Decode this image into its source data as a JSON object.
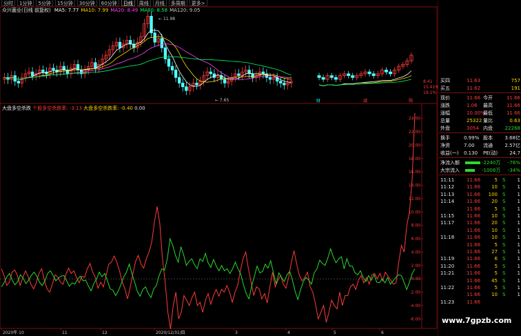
{
  "period_tabs": [
    "分时",
    "1分钟",
    "5分钟",
    "15分钟",
    "30分钟",
    "60分钟",
    "日线",
    "周线",
    "月线",
    "多周期",
    "更多>"
  ],
  "active_tab": "日线",
  "main_chart": {
    "name": "众兴菌业(日线 前复权)",
    "ma": [
      {
        "label": "MA5: 7.77",
        "color": "#ffffff"
      },
      {
        "label": "MA10: 7.99",
        "color": "#ffd700"
      },
      {
        "label": "MA20: 8.49",
        "color": "#ff44ff"
      },
      {
        "label": "MA60: 8.58",
        "color": "#00ff66"
      },
      {
        "label": "MA120: 9.05",
        "color": "#c8c8c8"
      }
    ],
    "high_label": "11.98",
    "low_label": "7.65",
    "right_labels": [
      "8.41",
      "15.41%",
      "19.1%"
    ],
    "markers": [
      "财",
      "减",
      "购"
    ]
  },
  "indicator": {
    "name": "大盘多空杀跌",
    "line1_label": "个股多空杀跌率: -3.13",
    "line1_color": "#ff3b3b",
    "line2_label": "大盘多空杀跌率: -0.40",
    "line2_color": "#2bd92b",
    "line3_label": "0.00",
    "y_ticks": [
      "24.00",
      "22.00",
      "20.00",
      "18.00",
      "16.00",
      "14.00",
      "12.00",
      "10.00",
      "8.00",
      "6.00",
      "4.00",
      "2.00",
      "0.00",
      "-2.00",
      "-4.00",
      "-6.00"
    ],
    "x_labels": [
      "2020年 10",
      "11",
      "12",
      "2020/12/31/四",
      "3",
      "4",
      "5",
      "6"
    ],
    "red_series": [
      1.5,
      0.5,
      -1,
      -0.5,
      1,
      1.3,
      0.5,
      -1,
      0.2,
      1.2,
      0.3,
      -0.8,
      -1.5,
      -0.6,
      0.8,
      1.5,
      -0.2,
      -1.5,
      -2,
      -0.8,
      0.6,
      0.3,
      -0.5,
      -0.8,
      0.6,
      1.6,
      0.8,
      1.2,
      0.2,
      -0.6,
      0.4,
      0.2,
      1.5,
      2.3,
      1,
      0.2,
      -1.4,
      -0.5,
      -1.2,
      0.5,
      2.2,
      2.5,
      3.4,
      2.5,
      1.2,
      -0.5,
      -1.5,
      -3,
      -1.2,
      0.8,
      2.6,
      3.5,
      2.2,
      1.6,
      3,
      4,
      5.5,
      8.5,
      10.8,
      8.3,
      3,
      -0.5,
      -5,
      -7.5,
      -4,
      -2,
      -6,
      -5,
      -2.5,
      -3.2,
      -4,
      -2.8,
      -2,
      -4,
      -3.5,
      -5,
      -3.2,
      -2.2,
      -3.8,
      -2.5,
      -1.6,
      -2.6,
      -1.6,
      -2,
      -1,
      -2,
      -3.5,
      -2,
      -1,
      1.2,
      3,
      4,
      1.5,
      -0.5,
      -2.5,
      -1.2,
      -1.5,
      -3,
      -2.2,
      -3.6,
      -1.2,
      1,
      -1.2,
      -0.2,
      0.5,
      -0.8,
      -1.4,
      0.2,
      2.5,
      4.2,
      2.2,
      0.5,
      -0.3,
      0.2,
      1,
      -1.2,
      -2,
      -3.8,
      -6,
      -5,
      -4,
      -6.5,
      -5,
      -3.2,
      -4,
      -4.5,
      -2,
      -4,
      -2.5,
      -2.5,
      -1.2,
      -0.8,
      -1.6,
      -0.2,
      0.5,
      -0.6,
      0.2,
      -0.8,
      0.6,
      0.8,
      0,
      0.8,
      -0.3,
      1,
      0.4,
      -0.2,
      -0.8,
      -0.6,
      2.5,
      5,
      4,
      8,
      10,
      15,
      24.8
    ],
    "green_series": [
      -1.2,
      -0.6,
      0.3,
      0.8,
      -0.2,
      -0.9,
      -0.4,
      0.6,
      0.1,
      -0.7,
      -0.2,
      0.5,
      1,
      0.4,
      -0.5,
      -1,
      -0.3,
      0.8,
      1.2,
      0.5,
      -0.3,
      0.1,
      0.4,
      0.5,
      -0.3,
      -1.1,
      -0.6,
      -0.8,
      -0.1,
      0.4,
      -0.3,
      -0.2,
      -1.1,
      -1.8,
      -0.7,
      0,
      1,
      0.3,
      0.8,
      -0.3,
      -1.5,
      -1.7,
      -2.5,
      -1.8,
      -0.8,
      0.3,
      1,
      2.2,
      0.8,
      -0.5,
      -1.9,
      -2.6,
      -1.6,
      -1.2,
      -2.2,
      -2.8,
      -1.5,
      -1,
      0.5,
      1.5,
      1.3,
      3,
      6,
      5,
      3.5,
      2.5,
      4.8,
      3.6,
      2,
      2.6,
      3,
      2.1,
      1.5,
      3,
      2.6,
      3.8,
      2.4,
      1.7,
      2.9,
      1.9,
      1.2,
      2,
      1.2,
      1.5,
      0.8,
      1.5,
      2.5,
      1.5,
      0.7,
      -0.9,
      -2.2,
      -3,
      -1.1,
      0.4,
      1.9,
      0.9,
      1.1,
      2.2,
      1.6,
      2.7,
      0.9,
      -0.8,
      0.9,
      0.2,
      -0.4,
      0.6,
      1.1,
      -0.2,
      -1.9,
      -3.1,
      -1.6,
      -0.4,
      0.2,
      -0.2,
      -0.8,
      0.9,
      1.5,
      2.8,
      2.3,
      2,
      3.1,
      4.5,
      3.3,
      2.4,
      3,
      3.3,
      1.5,
      3,
      1.9,
      1.9,
      0.9,
      0.6,
      1.2,
      0.2,
      -0.4,
      0.5,
      -0.2,
      0.6,
      -0.5,
      -0.6,
      0,
      -0.6,
      0.2,
      -0.8,
      -0.3,
      0.2,
      0.6,
      0.5,
      -0.5,
      -1.6,
      -0.5,
      0.8,
      1.5
    ]
  },
  "quote_panel": {
    "rows": [
      {
        "label": "买四",
        "price": "11.63",
        "vol": "757"
      },
      {
        "label": "买五",
        "price": "11.62",
        "vol": "191"
      }
    ],
    "stats": [
      {
        "l1": "现价",
        "v1": "11.66",
        "c1": "red",
        "l2": "今开",
        "v2": "11.66",
        "c2": "red"
      },
      {
        "l1": "涨跌",
        "v1": "1.06",
        "c1": "red",
        "l2": "最高",
        "v2": "11.66",
        "c2": "red"
      },
      {
        "l1": "涨幅",
        "v1": "10.00%",
        "c1": "red",
        "l2": "最低",
        "v2": "11.66",
        "c2": "red"
      },
      {
        "l1": "总量",
        "v1": "25322",
        "c1": "yellow",
        "l2": "量比",
        "v2": "0.63",
        "c2": "yellow"
      },
      {
        "l1": "外盘",
        "v1": "3054",
        "c1": "red",
        "l2": "内盘",
        "v2": "22268",
        "c2": "green"
      }
    ],
    "stats2": [
      {
        "l1": "换手",
        "v1": "0.99%",
        "c1": "white",
        "l2": "股本",
        "v2": "3.68亿",
        "c2": "white"
      },
      {
        "l1": "净资",
        "v1": "7.00",
        "c1": "white",
        "l2": "流通",
        "v2": "2.57亿",
        "c2": "white"
      },
      {
        "l1": "收益(一)",
        "v1": "0.130",
        "c1": "white",
        "l2": "PE(动)",
        "v2": "24.7",
        "c2": "white"
      }
    ],
    "flows": [
      {
        "label": "净流入额",
        "value": "-2240万",
        "pct": "-76%"
      },
      {
        "label": "大宗流入",
        "value": "-1008万",
        "pct": "-34%"
      }
    ],
    "trades": [
      {
        "time": "11:11",
        "price": "11.66",
        "vol": "5",
        "side": "S",
        "n": "1"
      },
      {
        "time": "11:12",
        "price": "11.66",
        "vol": "10",
        "side": "S",
        "n": "1"
      },
      {
        "time": "11:13",
        "price": "11.66",
        "vol": "100",
        "side": "S",
        "n": "1"
      },
      {
        "time": "11:14",
        "price": "11.66",
        "vol": "20",
        "side": "S",
        "n": "1"
      },
      {
        "time": "",
        "price": "11.66",
        "vol": "5",
        "side": "S",
        "n": "1"
      },
      {
        "time": "11:15",
        "price": "11.66",
        "vol": "10",
        "side": "S",
        "n": "1"
      },
      {
        "time": "11:17",
        "price": "11.66",
        "vol": "20",
        "side": "S",
        "n": "1"
      },
      {
        "time": "",
        "price": "11.66",
        "vol": "10",
        "side": "S",
        "n": "1"
      },
      {
        "time": "11:18",
        "price": "11.66",
        "vol": "10",
        "side": "S",
        "n": "1"
      },
      {
        "time": "",
        "price": "11.66",
        "vol": "5",
        "side": "S",
        "n": "1"
      },
      {
        "time": "",
        "price": "11.66",
        "vol": "27",
        "side": "S",
        "n": "1"
      },
      {
        "time": "11:19",
        "price": "11.66",
        "vol": "6",
        "side": "S",
        "n": "1"
      },
      {
        "time": "11:20",
        "price": "11.66",
        "vol": "5",
        "side": "S",
        "n": "1"
      },
      {
        "time": "11:21",
        "price": "11.66",
        "vol": "5",
        "side": "S",
        "n": "1"
      },
      {
        "time": "",
        "price": "11.66",
        "vol": "45",
        "side": "S",
        "n": "1"
      },
      {
        "time": "11:22",
        "price": "11.66",
        "vol": "5",
        "side": "S",
        "n": "1"
      },
      {
        "time": "",
        "price": "11.66",
        "vol": "10",
        "side": "S",
        "n": "1"
      },
      {
        "time": "11:23",
        "price": "11.66",
        "vol": "",
        "side": "",
        "n": ""
      }
    ]
  },
  "watermark": "www.7gpzb.com"
}
